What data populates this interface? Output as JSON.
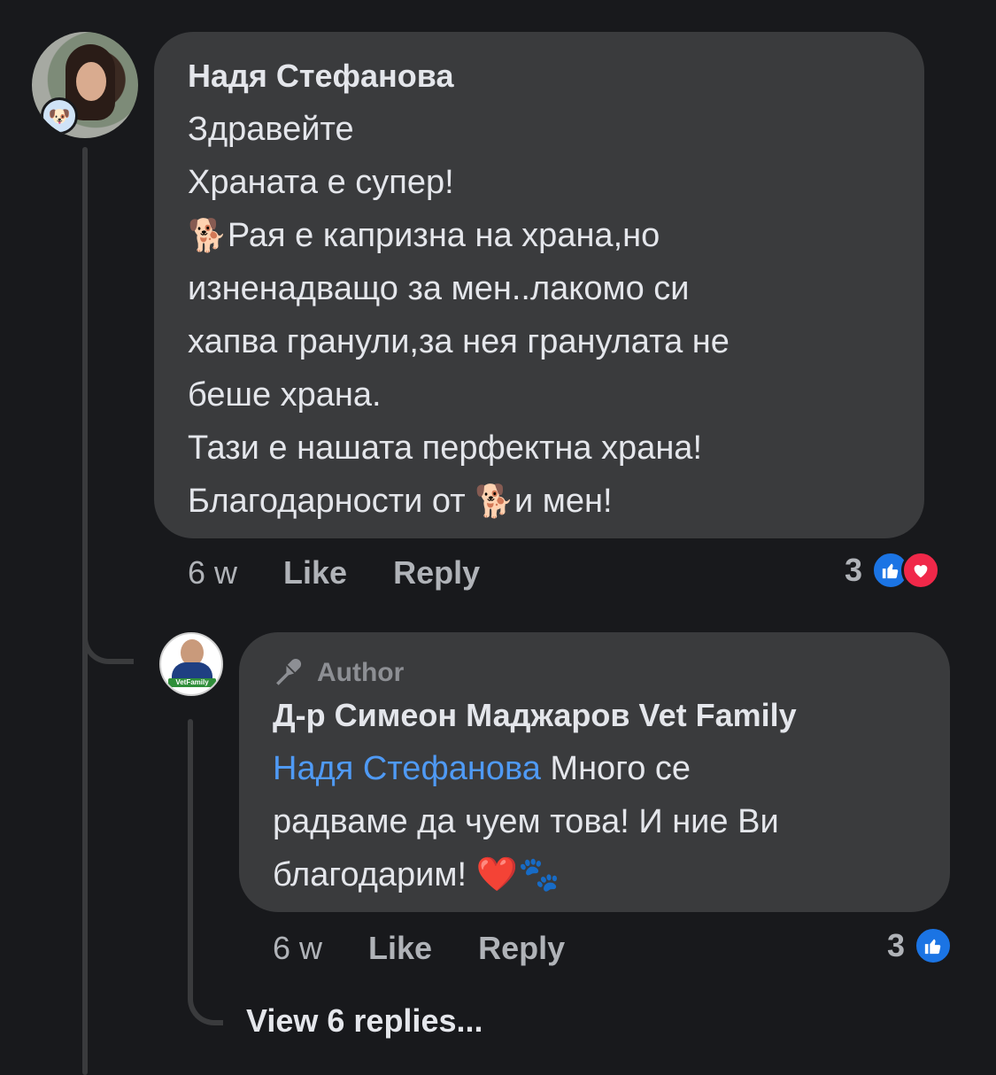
{
  "comment": {
    "author": "Надя Стефанова",
    "lines": [
      "Здравейте",
      "Храната е супер!",
      "Рая е капризна на храна,но",
      "изненадващо за мен..лакомо си",
      "хапва гранули,за нея гранулата не",
      "беше храна.",
      "Тази е нашата перфектна храна!",
      "Благодарности от",
      "и мен!"
    ],
    "emoji_dog": "🐕",
    "time": "6 w",
    "like_label": "Like",
    "reply_label": "Reply",
    "reaction_count": "3",
    "reactions": [
      "like-icon",
      "love-icon"
    ]
  },
  "reply": {
    "badge": "Author",
    "author": "Д-р Симеон Маджаров Vet Family",
    "mention": "Надя Стефанова",
    "text_after_mention": " Много се",
    "line2": "радваме да чуем това! И ние Ви",
    "line3": "благодарим!",
    "emoji_heart": "❤️",
    "emoji_paws": "🐾",
    "avatar_logo": "VetFamily",
    "time": "6 w",
    "like_label": "Like",
    "reply_label": "Reply",
    "reaction_count": "3",
    "reactions": [
      "like-icon"
    ]
  },
  "view_replies": "View 6 replies...",
  "colors": {
    "background": "#18191c",
    "bubble": "#3a3b3d",
    "mention": "#4f9af5",
    "like": "#1b74e4",
    "love": "#f02849"
  }
}
